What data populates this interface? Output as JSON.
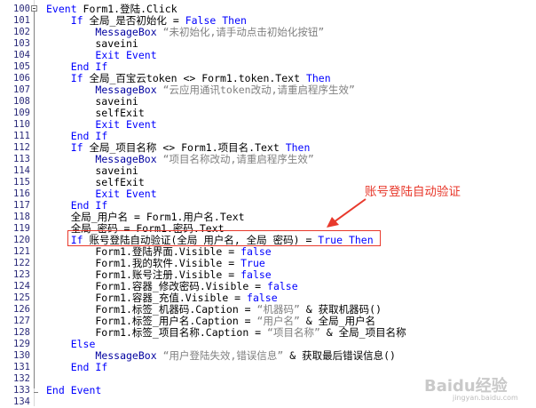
{
  "editor": {
    "lines": [
      {
        "no": "100",
        "segs": [
          [
            "kw",
            "Event"
          ],
          [
            "txt",
            " Form1.登陆.Click"
          ]
        ]
      },
      {
        "no": "101",
        "segs": [
          [
            "txt",
            "    "
          ],
          [
            "kw",
            "If"
          ],
          [
            "txt",
            " 全局_是否初始化 = "
          ],
          [
            "cn",
            "False"
          ],
          [
            "txt",
            " "
          ],
          [
            "kw",
            "Then"
          ]
        ]
      },
      {
        "no": "102",
        "segs": [
          [
            "txt",
            "        "
          ],
          [
            "fn",
            "MessageBox"
          ],
          [
            "str",
            " “未初始化,请手动点击初始化按钮”"
          ]
        ]
      },
      {
        "no": "103",
        "segs": [
          [
            "txt",
            "        saveini"
          ]
        ]
      },
      {
        "no": "104",
        "segs": [
          [
            "txt",
            "        "
          ],
          [
            "kw",
            "Exit Event"
          ]
        ]
      },
      {
        "no": "105",
        "segs": [
          [
            "txt",
            "    "
          ],
          [
            "kw",
            "End If"
          ]
        ]
      },
      {
        "no": "106",
        "segs": [
          [
            "txt",
            "    "
          ],
          [
            "kw",
            "If"
          ],
          [
            "txt",
            " 全局_百宝云token <> Form1.token.Text "
          ],
          [
            "kw",
            "Then"
          ]
        ]
      },
      {
        "no": "107",
        "segs": [
          [
            "txt",
            "        "
          ],
          [
            "fn",
            "MessageBox"
          ],
          [
            "str",
            " “云应用通讯token改动,请重启程序生效”"
          ]
        ]
      },
      {
        "no": "108",
        "segs": [
          [
            "txt",
            "        saveini"
          ]
        ]
      },
      {
        "no": "109",
        "segs": [
          [
            "txt",
            "        selfExit"
          ]
        ]
      },
      {
        "no": "110",
        "segs": [
          [
            "txt",
            "        "
          ],
          [
            "kw",
            "Exit Event"
          ]
        ]
      },
      {
        "no": "111",
        "segs": [
          [
            "txt",
            "    "
          ],
          [
            "kw",
            "End If"
          ]
        ]
      },
      {
        "no": "112",
        "segs": [
          [
            "txt",
            "    "
          ],
          [
            "kw",
            "If"
          ],
          [
            "txt",
            " 全局_项目名称 <> Form1.项目名.Text "
          ],
          [
            "kw",
            "Then"
          ]
        ]
      },
      {
        "no": "113",
        "segs": [
          [
            "txt",
            "        "
          ],
          [
            "fn",
            "MessageBox"
          ],
          [
            "str",
            " “项目名称改动,请重启程序生效”"
          ]
        ]
      },
      {
        "no": "114",
        "segs": [
          [
            "txt",
            "        saveini"
          ]
        ]
      },
      {
        "no": "115",
        "segs": [
          [
            "txt",
            "        selfExit"
          ]
        ]
      },
      {
        "no": "116",
        "segs": [
          [
            "txt",
            "        "
          ],
          [
            "kw",
            "Exit Event"
          ]
        ]
      },
      {
        "no": "117",
        "segs": [
          [
            "txt",
            "    "
          ],
          [
            "kw",
            "End If"
          ]
        ]
      },
      {
        "no": "118",
        "segs": [
          [
            "txt",
            "    全局_用户名 = Form1.用户名.Text"
          ]
        ]
      },
      {
        "no": "119",
        "segs": [
          [
            "txt",
            "    全局_密码 = Form1.密码.Text"
          ]
        ]
      },
      {
        "no": "120",
        "segs": [
          [
            "txt",
            "    "
          ],
          [
            "kw",
            "If"
          ],
          [
            "txt",
            " 账号登陆自动验证(全局_用户名, 全局_密码) = "
          ],
          [
            "cn",
            "True"
          ],
          [
            "txt",
            " "
          ],
          [
            "kw",
            "Then"
          ]
        ]
      },
      {
        "no": "121",
        "segs": [
          [
            "txt",
            "        Form1.登陆界面.Visible = "
          ],
          [
            "cn",
            "false"
          ]
        ]
      },
      {
        "no": "122",
        "segs": [
          [
            "txt",
            "        Form1.我的软件.Visible = "
          ],
          [
            "cn",
            "True"
          ]
        ]
      },
      {
        "no": "123",
        "segs": [
          [
            "txt",
            "        Form1.账号注册.Visible = "
          ],
          [
            "cn",
            "false"
          ]
        ]
      },
      {
        "no": "124",
        "segs": [
          [
            "txt",
            "        Form1.容器_修改密码.Visible = "
          ],
          [
            "cn",
            "false"
          ]
        ]
      },
      {
        "no": "125",
        "segs": [
          [
            "txt",
            "        Form1.容器_充值.Visible = "
          ],
          [
            "cn",
            "false"
          ]
        ]
      },
      {
        "no": "126",
        "segs": [
          [
            "txt",
            "        Form1.标签_机器码.Caption = "
          ],
          [
            "str",
            "“机器码”"
          ],
          [
            "txt",
            " & 获取机器码()"
          ]
        ]
      },
      {
        "no": "127",
        "segs": [
          [
            "txt",
            "        Form1.标签_用户名.Caption = "
          ],
          [
            "str",
            "“用户名”"
          ],
          [
            "txt",
            " & 全局_用户名"
          ]
        ]
      },
      {
        "no": "128",
        "segs": [
          [
            "txt",
            "        Form1.标签_项目名称.Caption = "
          ],
          [
            "str",
            "“项目名称”"
          ],
          [
            "txt",
            " & 全局_项目名称"
          ]
        ]
      },
      {
        "no": "129",
        "segs": [
          [
            "txt",
            "    "
          ],
          [
            "kw",
            "Else"
          ]
        ]
      },
      {
        "no": "130",
        "segs": [
          [
            "txt",
            "        "
          ],
          [
            "fn",
            "MessageBox"
          ],
          [
            "str",
            " “用户登陆失效,错误信息”"
          ],
          [
            "txt",
            " & 获取最后错误信息()"
          ]
        ]
      },
      {
        "no": "131",
        "segs": [
          [
            "txt",
            "    "
          ],
          [
            "kw",
            "End If"
          ]
        ]
      },
      {
        "no": "132",
        "segs": []
      },
      {
        "no": "133",
        "segs": [
          [
            "kw",
            "End Event"
          ]
        ]
      },
      {
        "no": "134",
        "segs": []
      }
    ]
  },
  "annotation": {
    "label": "账号登陆自动验证",
    "color": "#e8392c"
  },
  "watermark": {
    "logo": "Baidu经验",
    "url": "jingyan.baidu.com"
  }
}
